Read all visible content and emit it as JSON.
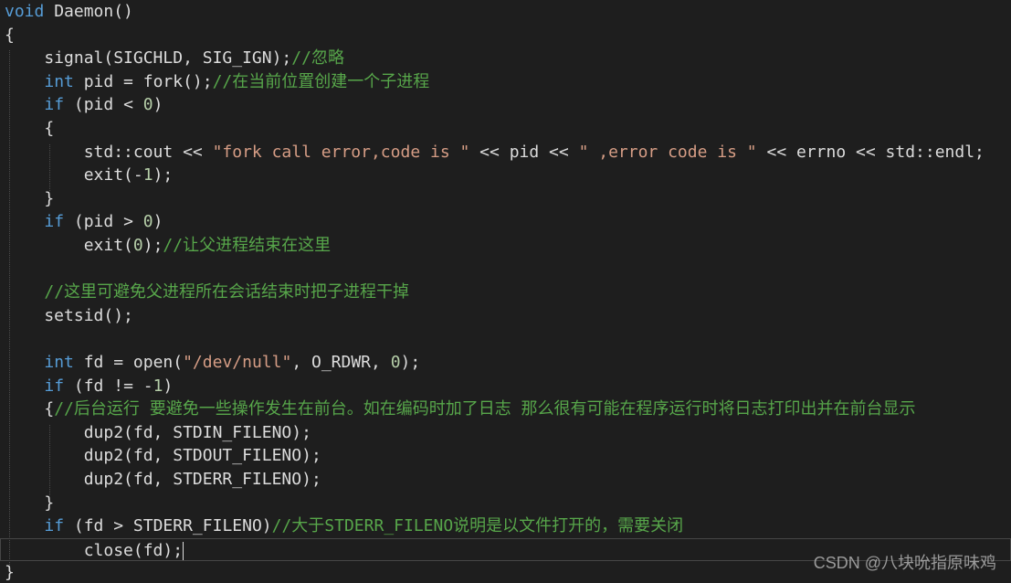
{
  "editor": {
    "theme_colors": {
      "background": "#1e1e1e",
      "keyword": "#569cd6",
      "comment": "#57a64a",
      "string": "#d69d85",
      "plain": "#dcdcdc"
    },
    "lines": [
      [
        {
          "t": "void",
          "c": "kw"
        },
        {
          "t": " Daemon()",
          "c": "pl"
        }
      ],
      [
        {
          "t": "{",
          "c": "pl"
        }
      ],
      [
        {
          "t": "    signal(SIGCHLD, SIG_IGN);",
          "c": "pl"
        },
        {
          "t": "//忽略",
          "c": "cm"
        }
      ],
      [
        {
          "t": "    ",
          "c": "pl"
        },
        {
          "t": "int",
          "c": "kw"
        },
        {
          "t": " pid = fork();",
          "c": "pl"
        },
        {
          "t": "//在当前位置创建一个子进程",
          "c": "cm"
        }
      ],
      [
        {
          "t": "    ",
          "c": "pl"
        },
        {
          "t": "if",
          "c": "kw"
        },
        {
          "t": " (pid < ",
          "c": "pl"
        },
        {
          "t": "0",
          "c": "nm"
        },
        {
          "t": ")",
          "c": "pl"
        }
      ],
      [
        {
          "t": "    {",
          "c": "pl"
        }
      ],
      [
        {
          "t": "        std::cout << ",
          "c": "pl"
        },
        {
          "t": "\"fork call error,code is \"",
          "c": "st"
        },
        {
          "t": " << pid << ",
          "c": "pl"
        },
        {
          "t": "\" ,error code is \"",
          "c": "st"
        },
        {
          "t": " << errno << std::endl;",
          "c": "pl"
        }
      ],
      [
        {
          "t": "        exit(-",
          "c": "pl"
        },
        {
          "t": "1",
          "c": "nm"
        },
        {
          "t": ");",
          "c": "pl"
        }
      ],
      [
        {
          "t": "    }",
          "c": "pl"
        }
      ],
      [
        {
          "t": "    ",
          "c": "pl"
        },
        {
          "t": "if",
          "c": "kw"
        },
        {
          "t": " (pid > ",
          "c": "pl"
        },
        {
          "t": "0",
          "c": "nm"
        },
        {
          "t": ")",
          "c": "pl"
        }
      ],
      [
        {
          "t": "        exit(",
          "c": "pl"
        },
        {
          "t": "0",
          "c": "nm"
        },
        {
          "t": ");",
          "c": "pl"
        },
        {
          "t": "//让父进程结束在这里",
          "c": "cm"
        }
      ],
      [
        {
          "t": "",
          "c": "pl"
        }
      ],
      [
        {
          "t": "    ",
          "c": "pl"
        },
        {
          "t": "//这里可避免父进程所在会话结束时把子进程干掉",
          "c": "cm"
        }
      ],
      [
        {
          "t": "    setsid();",
          "c": "pl"
        }
      ],
      [
        {
          "t": "",
          "c": "pl"
        }
      ],
      [
        {
          "t": "    ",
          "c": "pl"
        },
        {
          "t": "int",
          "c": "kw"
        },
        {
          "t": " fd = open(",
          "c": "pl"
        },
        {
          "t": "\"/dev/null\"",
          "c": "st"
        },
        {
          "t": ", O_RDWR, ",
          "c": "pl"
        },
        {
          "t": "0",
          "c": "nm"
        },
        {
          "t": ");",
          "c": "pl"
        }
      ],
      [
        {
          "t": "    ",
          "c": "pl"
        },
        {
          "t": "if",
          "c": "kw"
        },
        {
          "t": " (fd != -",
          "c": "pl"
        },
        {
          "t": "1",
          "c": "nm"
        },
        {
          "t": ")",
          "c": "pl"
        }
      ],
      [
        {
          "t": "    {",
          "c": "pl"
        },
        {
          "t": "//后台运行 要避免一些操作发生在前台。如在编码时加了日志 那么很有可能在程序运行时将日志打印出并在前台显示",
          "c": "cm"
        }
      ],
      [
        {
          "t": "        dup2(fd, STDIN_FILENO);",
          "c": "pl"
        }
      ],
      [
        {
          "t": "        dup2(fd, STDOUT_FILENO);",
          "c": "pl"
        }
      ],
      [
        {
          "t": "        dup2(fd, STDERR_FILENO);",
          "c": "pl"
        }
      ],
      [
        {
          "t": "    }",
          "c": "pl"
        }
      ],
      [
        {
          "t": "    ",
          "c": "pl"
        },
        {
          "t": "if",
          "c": "kw"
        },
        {
          "t": " (fd > STDERR_FILENO)",
          "c": "pl"
        },
        {
          "t": "//大于STDERR_FILENO说明是以文件打开的，需要关闭",
          "c": "cm"
        }
      ],
      [
        {
          "t": "        close(fd);",
          "c": "pl"
        }
      ],
      [
        {
          "t": "}",
          "c": "pl"
        }
      ]
    ],
    "current_line_index": 23
  },
  "watermark": "CSDN @八块吮指原味鸡"
}
